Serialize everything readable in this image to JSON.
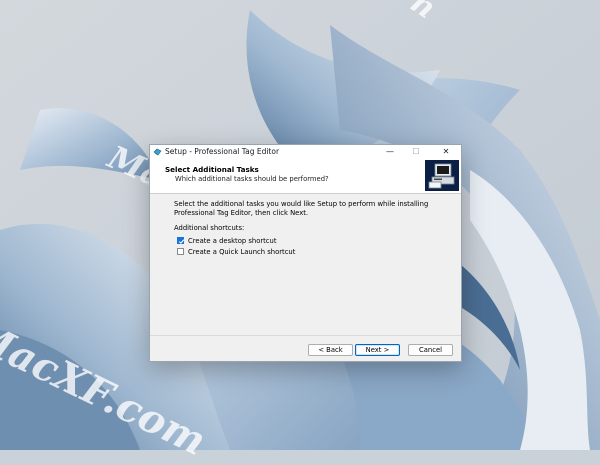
{
  "watermark": {
    "text_top": "n",
    "text_mid": "MacXF",
    "text_bottom": "MacXF.com"
  },
  "window": {
    "title": "Setup - Professional Tag Editor",
    "controls": {
      "minimize": "—",
      "maximize": "☐",
      "close": "✕"
    }
  },
  "header": {
    "title": "Select Additional Tasks",
    "subtitle": "Which additional tasks should be performed?"
  },
  "content": {
    "description": "Select the additional tasks you would like Setup to perform while installing Professional Tag Editor, then click Next.",
    "shortcuts_label": "Additional shortcuts:",
    "options": [
      {
        "label": "Create a desktop shortcut",
        "checked": true
      },
      {
        "label": "Create a Quick Launch shortcut",
        "checked": false
      }
    ]
  },
  "buttons": {
    "back": "< Back",
    "next": "Next >",
    "cancel": "Cancel"
  },
  "colors": {
    "accent": "#1a73d9",
    "logo_bg": "#0b1f44"
  }
}
